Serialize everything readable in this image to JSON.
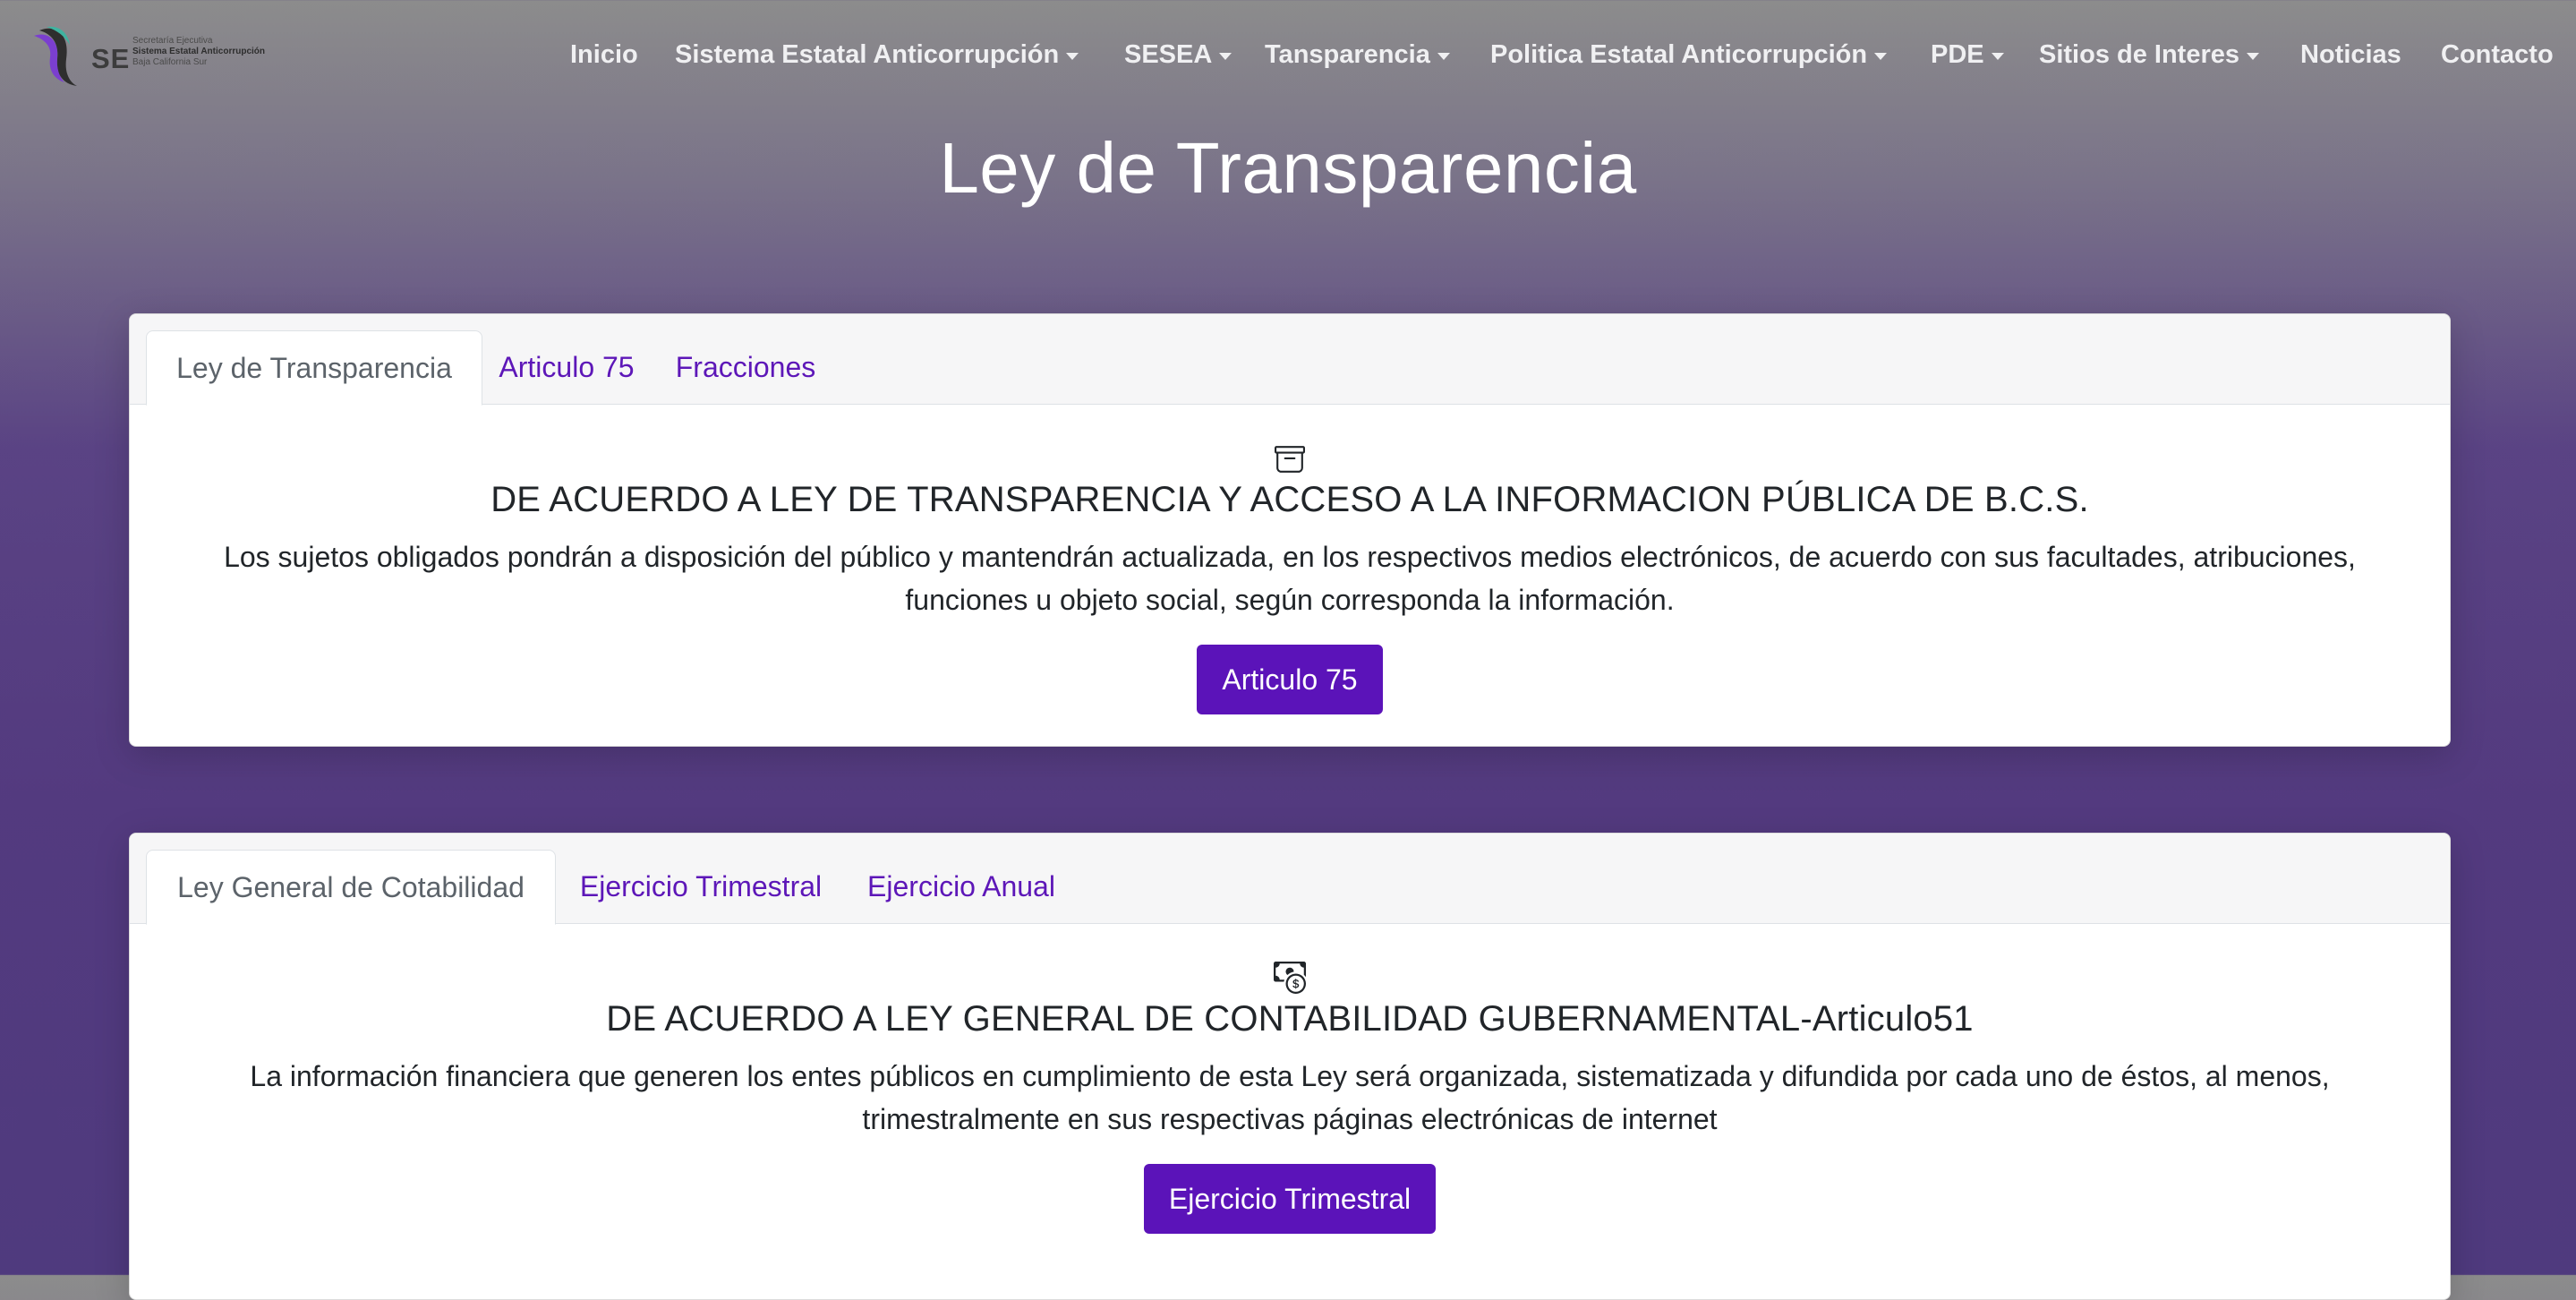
{
  "brand": {
    "abbr": "SE",
    "line1": "Secretaría Ejecutiva",
    "line2": "Sistema Estatal Anticorrupción",
    "line3": "Baja California Sur"
  },
  "nav": {
    "items": [
      {
        "label": "Inicio",
        "dropdown": false
      },
      {
        "label": "Sistema Estatal Anticorrupción",
        "dropdown": true
      },
      {
        "label": "SESEA",
        "dropdown": true
      },
      {
        "label": "Tansparencia",
        "dropdown": true
      },
      {
        "label": "Politica Estatal Anticorrupción",
        "dropdown": true
      },
      {
        "label": "PDE",
        "dropdown": true
      },
      {
        "label": "Sitios de Interes",
        "dropdown": true
      },
      {
        "label": "Noticias",
        "dropdown": false
      },
      {
        "label": "Contacto",
        "dropdown": false
      }
    ]
  },
  "page": {
    "title": "Ley de Transparencia"
  },
  "card1": {
    "tabs": [
      "Ley de Transparencia",
      "Articulo 75",
      "Fracciones"
    ],
    "active_tab": 0,
    "icon": "archive-icon",
    "heading": "DE ACUERDO A LEY DE TRANSPARENCIA Y ACCESO A LA INFORMACION PÚBLICA DE B.C.S.",
    "text_line1": "Los sujetos obligados pondrán a disposición del público y mantendrán actualizada, en los respectivos medios electrónicos, de acuerdo con sus facultades, atribuciones,",
    "text_line2": "funciones u objeto social, según corresponda la información.",
    "button": "Articulo 75"
  },
  "card2": {
    "tabs": [
      "Ley General de Cotabilidad",
      "Ejercicio Trimestral",
      "Ejercicio Anual"
    ],
    "active_tab": 0,
    "icon": "cash-coin-icon",
    "heading": "DE ACUERDO A LEY GENERAL DE CONTABILIDAD GUBERNAMENTAL-Articulo51",
    "text_line1": "La información financiera que generen los entes públicos en cumplimiento de esta Ley será organizada, sistematizada y difundida por cada uno de éstos, al menos,",
    "text_line2": "trimestralmente en sus respectivas páginas electrónicas de internet",
    "button": "Ejercicio Trimestral"
  },
  "colors": {
    "accent": "#5b13b9",
    "tab_link": "#5d17b8",
    "nav_text": "#f0f0f2"
  }
}
